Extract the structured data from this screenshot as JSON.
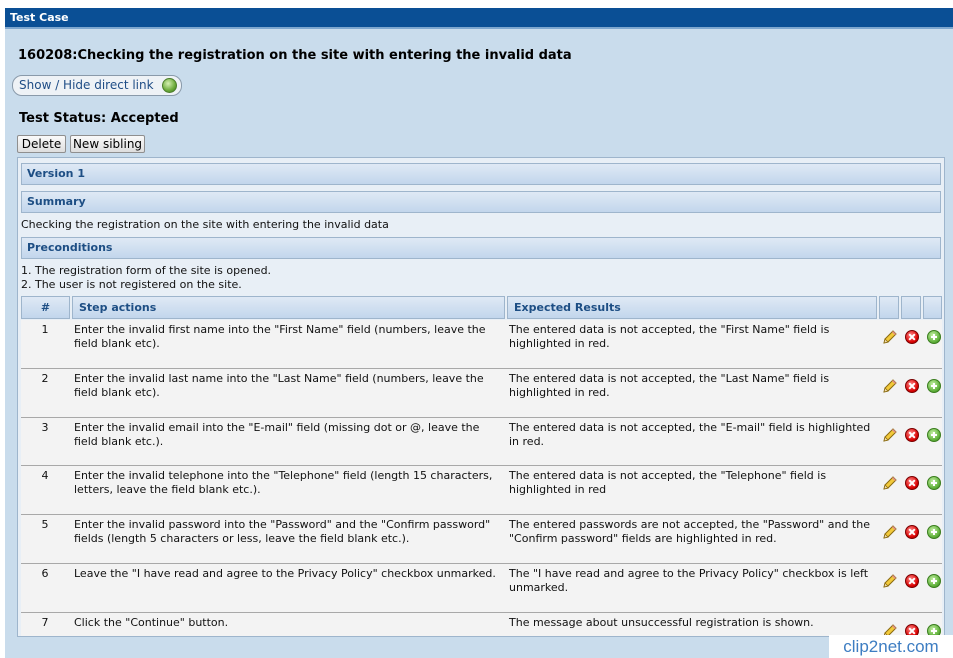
{
  "window": {
    "title": "Test Case"
  },
  "header": {
    "test_title": "160208:Checking the registration on the site with entering the invalid data",
    "direct_link_label": "Show / Hide direct link",
    "status": "Test Status: Accepted"
  },
  "actions": {
    "delete_label": "Delete",
    "new_sibling_label": "New sibling"
  },
  "version": {
    "label": "Version 1"
  },
  "summary": {
    "label": "Summary",
    "text": "Checking the registration on the site with entering the invalid data"
  },
  "preconditions": {
    "label": "Preconditions",
    "lines": [
      "1. The registration form of the site is opened.",
      "2. The user is not registered on the site."
    ]
  },
  "steps_table": {
    "columns": [
      "#",
      "Step actions",
      "Expected Results"
    ],
    "rows": [
      {
        "num": "1",
        "action": "Enter the invalid first name into the \"First Name\" field (numbers, leave the field blank etc).",
        "expected": "The entered data is not accepted, the \"First Name\" field is highlighted in red."
      },
      {
        "num": "2",
        "action": "Enter the invalid last name into the \"Last Name\" field (numbers, leave the field blank etc).",
        "expected": "The entered data is not accepted, the \"Last Name\" field is highlighted in red."
      },
      {
        "num": "3",
        "action": "Enter the invalid email into the \"E-mail\" field (missing dot or @, leave the field blank etc.).",
        "expected": "The entered data is not accepted, the \"E-mail\" field is highlighted in red."
      },
      {
        "num": "4",
        "action": "Enter the invalid telephone into the \"Telephone\" field (length 15 characters, letters, leave the field blank etc.).",
        "expected": "The entered data is not accepted, the \"Telephone\" field is highlighted in red"
      },
      {
        "num": "5",
        "action": "Enter the invalid password into the \"Password\" and the \"Confirm password\" fields (length 5 characters or less, leave the field blank etc.).",
        "expected": "The entered passwords are not accepted, the \"Password\" and the \"Confirm password\" fields are highlighted in red."
      },
      {
        "num": "6",
        "action": "Leave the \"I have read and agree to the Privacy Policy\" checkbox unmarked.",
        "expected": "The \"I have read and agree to the Privacy Policy\" checkbox is left unmarked."
      },
      {
        "num": "7",
        "action": "Click the \"Continue\" button.",
        "expected": "The message about unsuccessful registration is shown."
      }
    ],
    "row_icons": [
      "pencil-icon",
      "delete-icon",
      "add-icon"
    ]
  },
  "watermark": {
    "text": "clip2net.com"
  },
  "colors": {
    "titlebar": "#0a4f95",
    "panel": "#c9dcec",
    "header_text": "#1d4e84",
    "delete": "#d90000",
    "add": "#5fb03a"
  }
}
